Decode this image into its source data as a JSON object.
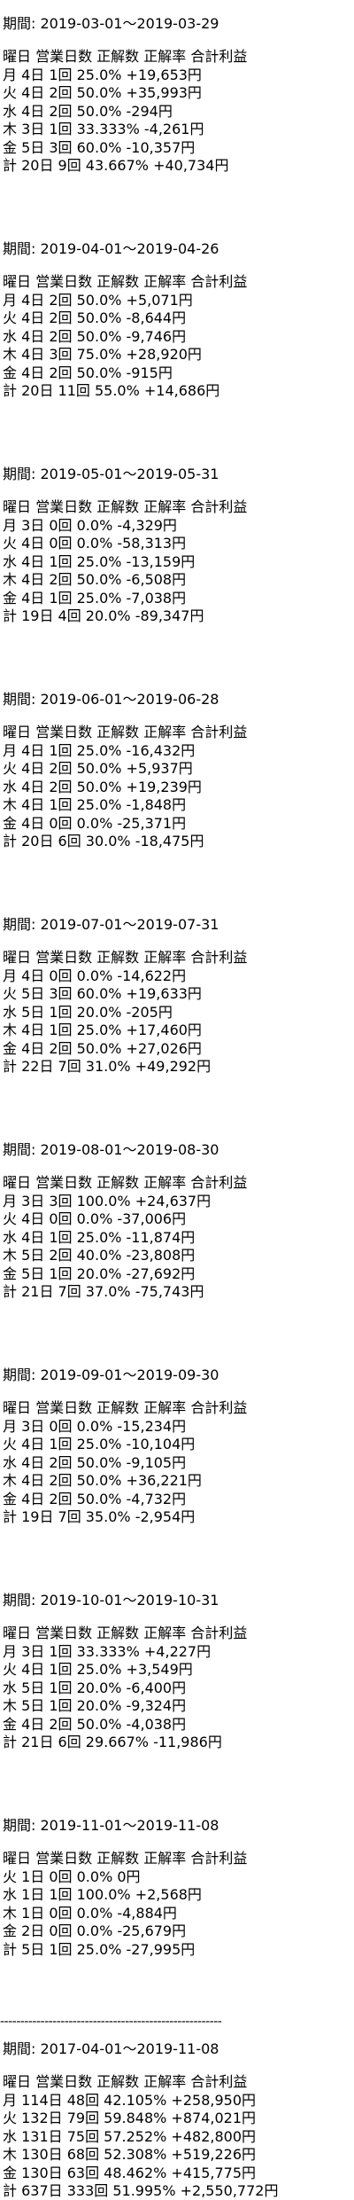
{
  "sections": [
    {
      "period": "期間: 2019-03-01～2019-03-29",
      "header": "曜日 営業日数 正解数 正解率 合計利益",
      "rows": [
        "月 4日 1回 25.0% +19,653円",
        "火 4日 2回 50.0% +35,993円",
        "水 4日 2回 50.0% -294円",
        "木 3日 1回 33.333% -4,261円",
        "金 5日 3回 60.0% -10,357円",
        "計 20日 9回 43.667% +40,734円"
      ]
    },
    {
      "period": "期間: 2019-04-01～2019-04-26",
      "header": "曜日 営業日数 正解数 正解率 合計利益",
      "rows": [
        "月 4日 2回 50.0% +5,071円",
        "火 4日 2回 50.0% -8,644円",
        "水 4日 2回 50.0% -9,746円",
        "木 4日 3回 75.0% +28,920円",
        "金 4日 2回 50.0% -915円",
        "計 20日 11回 55.0% +14,686円"
      ]
    },
    {
      "period": "期間: 2019-05-01～2019-05-31",
      "header": "曜日 営業日数 正解数 正解率 合計利益",
      "rows": [
        "月 3日 0回 0.0% -4,329円",
        "火 4日 0回 0.0% -58,313円",
        "水 4日 1回 25.0% -13,159円",
        "木 4日 2回 50.0% -6,508円",
        "金 4日 1回 25.0% -7,038円",
        "計 19日 4回 20.0% -89,347円"
      ]
    },
    {
      "period": "期間: 2019-06-01～2019-06-28",
      "header": "曜日 営業日数 正解数 正解率 合計利益",
      "rows": [
        "月 4日 1回 25.0% -16,432円",
        "火 4日 2回 50.0% +5,937円",
        "水 4日 2回 50.0% +19,239円",
        "木 4日 1回 25.0% -1,848円",
        "金 4日 0回 0.0% -25,371円",
        "計 20日 6回 30.0% -18,475円"
      ]
    },
    {
      "period": "期間: 2019-07-01～2019-07-31",
      "header": "曜日 営業日数 正解数 正解率 合計利益",
      "rows": [
        "月 4日 0回 0.0% -14,622円",
        "火 5日 3回 60.0% +19,633円",
        "水 5日 1回 20.0% -205円",
        "木 4日 1回 25.0% +17,460円",
        "金 4日 2回 50.0% +27,026円",
        "計 22日 7回 31.0% +49,292円"
      ]
    },
    {
      "period": "期間: 2019-08-01～2019-08-30",
      "header": "曜日 営業日数 正解数 正解率 合計利益",
      "rows": [
        "月 3日 3回 100.0% +24,637円",
        "火 4日 0回 0.0% -37,006円",
        "水 4日 1回 25.0% -11,874円",
        "木 5日 2回 40.0% -23,808円",
        "金 5日 1回 20.0% -27,692円",
        "計 21日 7回 37.0% -75,743円"
      ]
    },
    {
      "period": "期間: 2019-09-01～2019-09-30",
      "header": "曜日 営業日数 正解数 正解率 合計利益",
      "rows": [
        "月 3日 0回 0.0% -15,234円",
        "火 4日 1回 25.0% -10,104円",
        "水 4日 2回 50.0% -9,105円",
        "木 4日 2回 50.0% +36,221円",
        "金 4日 2回 50.0% -4,732円",
        "計 19日 7回 35.0% -2,954円"
      ]
    },
    {
      "period": "期間: 2019-10-01～2019-10-31",
      "header": "曜日 営業日数 正解数 正解率 合計利益",
      "rows": [
        "月 3日 1回 33.333% +4,227円",
        "火 4日 1回 25.0% +3,549円",
        "水 5日 1回 20.0% -6,400円",
        "木 5日 1回 20.0% -9,324円",
        "金 4日 2回 50.0% -4,038円",
        "計 21日 6回 29.667% -11,986円"
      ]
    },
    {
      "period": "期間: 2019-11-01～2019-11-08",
      "header": "曜日 営業日数 正解数 正解率 合計利益",
      "rows": [
        "火 1日 0回 0.0% 0円",
        "水 1日 1回 100.0% +2,568円",
        "木 1日 0回 0.0% -4,884円",
        "金 2日 0回 0.0% -25,679円",
        "計 5日 1回 25.0% -27,995円"
      ]
    }
  ],
  "separator": "-------------------------------------------------------",
  "summary": {
    "period": "期間: 2017-04-01～2019-11-08",
    "header": "曜日 営業日数 正解数 正解率 合計利益",
    "rows": [
      "月 114日 48回 42.105% +258,950円",
      "火 132日 79回 59.848% +874,021円",
      "水 131日 75回 57.252% +482,800円",
      "木 130日 68回 52.308% +519,226円",
      "金 130日 63回 48.462% +415,775円",
      "計 637日 333回 51.995% +2,550,772円"
    ]
  }
}
